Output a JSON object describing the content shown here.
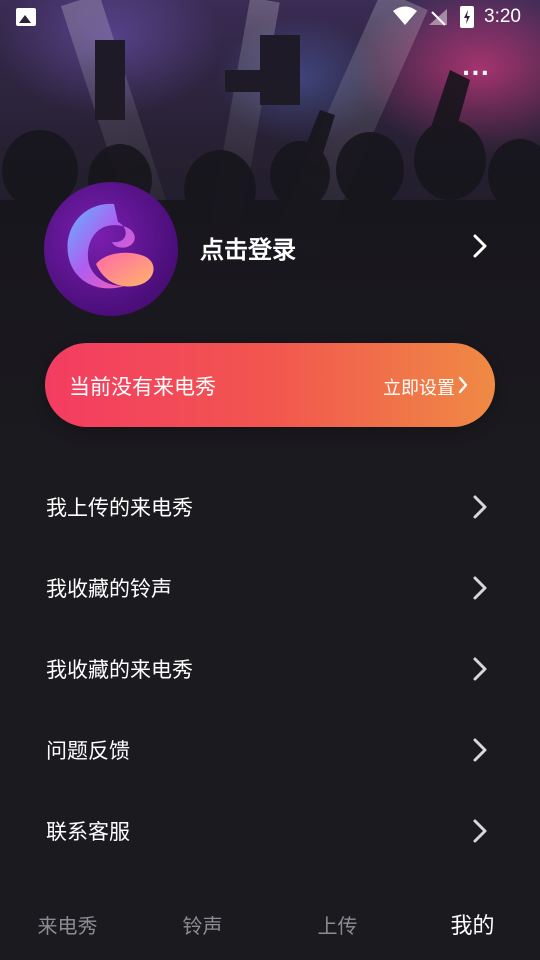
{
  "status_bar": {
    "time": "3:20",
    "icons": [
      "image-icon",
      "wifi-icon",
      "signal-off-icon",
      "battery-charging-icon"
    ]
  },
  "header": {
    "more_label": "..."
  },
  "profile": {
    "login_label": "点击登录",
    "avatar_icon": "app-logo-icon"
  },
  "banner": {
    "message": "当前没有来电秀",
    "action_label": "立即设置",
    "colors": [
      "#f33c62",
      "#ef8a44"
    ]
  },
  "menu": {
    "items": [
      {
        "label": "我上传的来电秀"
      },
      {
        "label": "我收藏的铃声"
      },
      {
        "label": "我收藏的来电秀"
      },
      {
        "label": "问题反馈"
      },
      {
        "label": "联系客服"
      }
    ]
  },
  "tabbar": {
    "tabs": [
      {
        "label": "来电秀"
      },
      {
        "label": "铃声"
      },
      {
        "label": "上传"
      },
      {
        "label": "我的"
      }
    ],
    "active_index": 3
  }
}
